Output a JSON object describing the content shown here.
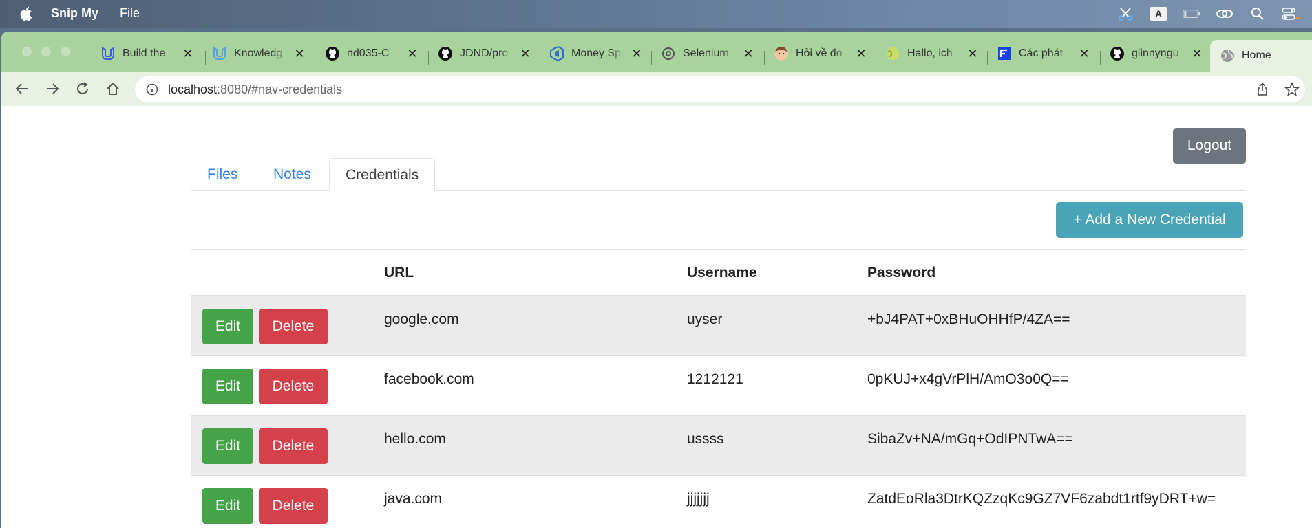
{
  "menubar": {
    "app_name": "Snip My",
    "file_menu": "File",
    "keyboard_indicator": "A"
  },
  "browser": {
    "tabs": [
      {
        "title": "Build the",
        "icon": "udacity-icon",
        "color": "#3a5bd6"
      },
      {
        "title": "Knowledg",
        "icon": "udacity-icon",
        "color": "#5aa0e0"
      },
      {
        "title": "nd035-C",
        "icon": "github-icon",
        "color": "#111111"
      },
      {
        "title": "JDND/pro",
        "icon": "github-icon",
        "color": "#111111"
      },
      {
        "title": "Money Sp",
        "icon": "azure-devops-icon",
        "color": "#2f6fd0"
      },
      {
        "title": "Selenium",
        "icon": "openai-icon",
        "color": "#555555"
      },
      {
        "title": "Hỏi về đo",
        "icon": "avatar-icon",
        "color": "#c07040"
      },
      {
        "title": "Hallo, ich",
        "icon": "globe-icon",
        "color": "#a8c840"
      },
      {
        "title": "Các phát",
        "icon": "document-icon",
        "color": "#1a40e0"
      },
      {
        "title": "giinnyngu",
        "icon": "github-icon",
        "color": "#111111"
      }
    ],
    "active_tab": {
      "title": "Home",
      "icon": "globe-icon"
    },
    "url_host": "localhost",
    "url_path": ":8080/#nav-credentials"
  },
  "page": {
    "logout_label": "Logout",
    "nav_tabs": [
      {
        "label": "Files"
      },
      {
        "label": "Notes"
      },
      {
        "label": "Credentials"
      }
    ],
    "active_nav_tab": "Credentials",
    "add_credential_label": "+ Add a New Credential",
    "table": {
      "headers": {
        "url": "URL",
        "username": "Username",
        "password": "Password"
      },
      "edit_label": "Edit",
      "delete_label": "Delete",
      "rows": [
        {
          "url": "google.com",
          "username": "uyser",
          "password": "+bJ4PAT+0xBHuOHHfP/4ZA=="
        },
        {
          "url": "facebook.com",
          "username": "1212121",
          "password": "0pKUJ+x4gVrPlH/AmO3o0Q=="
        },
        {
          "url": "hello.com",
          "username": "ussss",
          "password": "SibaZv+NA/mGq+OdIPNTwA=="
        },
        {
          "url": "java.com",
          "username": "jjjjjjj",
          "password": "ZatdEoRla3DtrKQZzqKc9GZ7VF6zabdt1rtf9yDRT+w="
        }
      ]
    }
  },
  "colors": {
    "tabstrip": "#a8d39c",
    "toolbar": "#e7f2e2",
    "edit_button": "#45a348",
    "delete_button": "#d5414a",
    "add_button": "#4aa4b8",
    "logout_button": "#6c757d",
    "link_blue": "#2f7fec"
  }
}
